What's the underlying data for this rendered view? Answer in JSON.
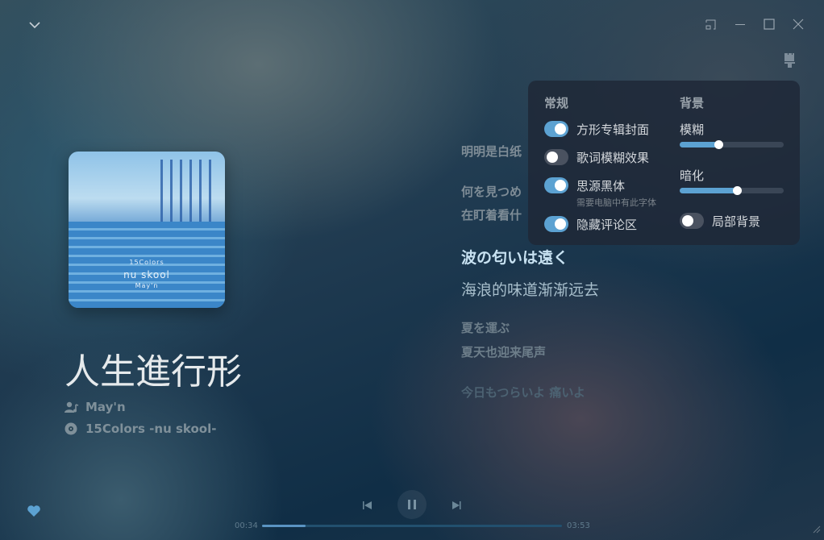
{
  "window": {
    "controls": [
      "collapse-icon",
      "mini-mode-icon",
      "minimize-icon",
      "maximize-icon",
      "close-icon"
    ]
  },
  "song": {
    "title": "人生進行形",
    "artist": "May'n",
    "album": "15Colors -nu skool-",
    "cover_text": [
      "15Colors",
      "nu skool",
      "May'n"
    ]
  },
  "lyrics": [
    {
      "text": "明明是白纸",
      "state": "past"
    },
    {
      "text": "何を見つめ",
      "state": "past"
    },
    {
      "text": "在盯着看什",
      "state": "past"
    },
    {
      "text": "波の匂いは遠く",
      "state": "current"
    },
    {
      "text": "海浪的味道渐渐远去",
      "state": "current-translation"
    },
    {
      "text": "夏を運ぶ",
      "state": "next"
    },
    {
      "text": "夏天也迎来尾声",
      "state": "next"
    },
    {
      "text": "今日もつらいよ 痛いよ",
      "state": "future"
    }
  ],
  "settings": {
    "general_title": "常规",
    "toggles": [
      {
        "label": "方形专辑封面",
        "on": true
      },
      {
        "label": "歌词模糊效果",
        "on": false
      },
      {
        "label": "思源黑体",
        "on": true,
        "hint": "需要电脑中有此字体"
      },
      {
        "label": "隐藏评论区",
        "on": true
      }
    ],
    "background_title": "背景",
    "blur": {
      "label": "模糊",
      "value": 0.37
    },
    "dim": {
      "label": "暗化",
      "value": 0.55
    },
    "local_bg": {
      "label": "局部背景",
      "on": false
    }
  },
  "player": {
    "current": "00:34",
    "total": "03:53",
    "progress": 0.146,
    "state": "playing",
    "accent": "#5ca2d2"
  }
}
